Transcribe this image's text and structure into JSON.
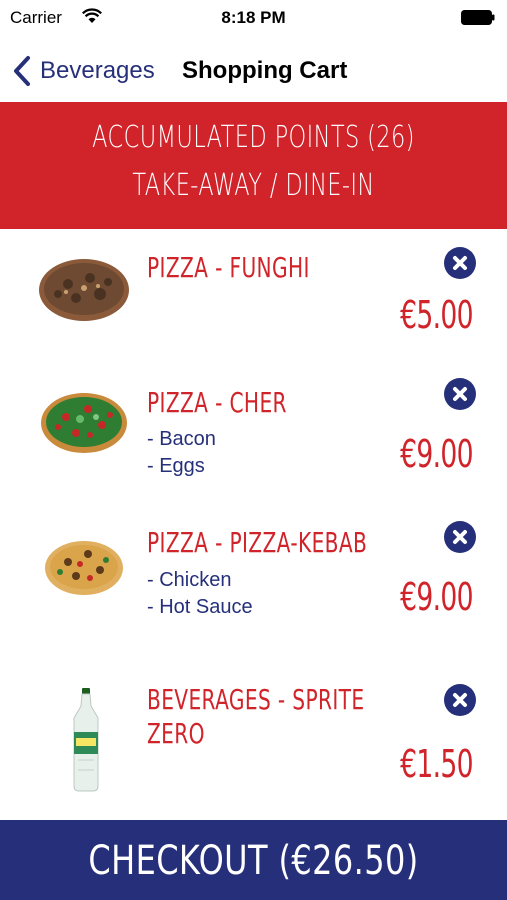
{
  "status_bar": {
    "carrier": "Carrier",
    "time": "8:18 PM"
  },
  "nav": {
    "back_label": "Beverages",
    "title": "Shopping Cart"
  },
  "banner": {
    "points_text": "ACCUMULATED POINTS (26)",
    "mode_text": "TAKE-AWAY / DINE-IN"
  },
  "colors": {
    "red": "#d0232a",
    "navy": "#26307a"
  },
  "cart": {
    "items": [
      {
        "title": "PIZZA - FUNGHI",
        "extras": [],
        "price": "€5.00",
        "image": "pizza-funghi-image",
        "remove_icon": "remove-x-icon"
      },
      {
        "title": "PIZZA - CHER",
        "extras": [
          "- Bacon",
          "- Eggs"
        ],
        "price": "€9.00",
        "image": "pizza-cher-image",
        "remove_icon": "remove-x-icon"
      },
      {
        "title": "PIZZA - PIZZA-KEBAB",
        "extras": [
          "- Chicken",
          "- Hot Sauce"
        ],
        "price": "€9.00",
        "image": "pizza-kebab-image",
        "remove_icon": "remove-x-icon"
      },
      {
        "title": "BEVERAGES - SPRITE",
        "title_line2": "ZERO",
        "extras": [],
        "price": "€1.50",
        "image": "sprite-zero-bottle-image",
        "remove_icon": "remove-x-icon"
      }
    ]
  },
  "checkout": {
    "label": "CHECKOUT (€26.50)"
  }
}
